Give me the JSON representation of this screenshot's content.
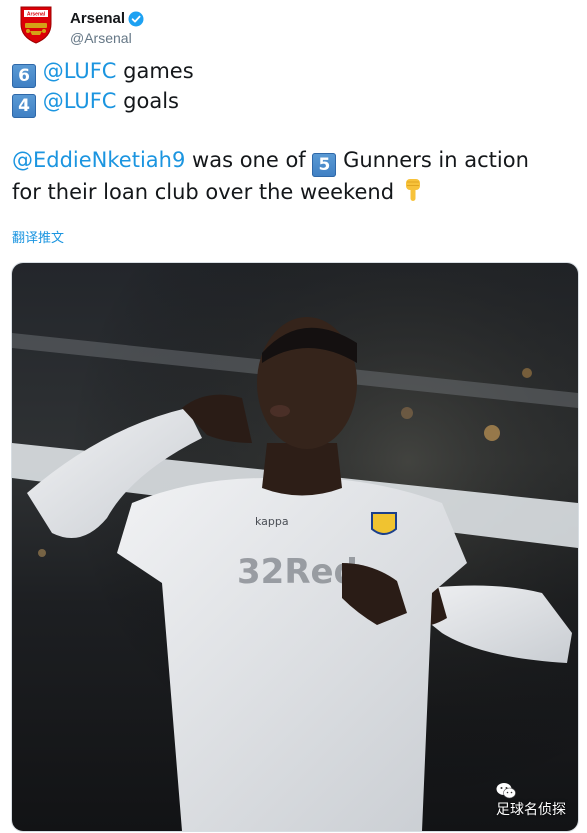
{
  "account": {
    "display_name": "Arsenal",
    "handle": "@Arsenal",
    "verified": true,
    "crest_icon": "arsenal-crest-icon"
  },
  "tweet": {
    "line1": {
      "badge": "6",
      "mention": "@LUFC",
      "text": "games"
    },
    "line2": {
      "badge": "4",
      "mention": "@LUFC",
      "text": "goals"
    },
    "line3": {
      "mention": "@EddieNketiah9",
      "text_before_badge": "was one of",
      "badge": "5",
      "text_after_badge": "Gunners in action"
    },
    "line4": {
      "text": "for their loan club over the weekend",
      "emoji": "pointing-down-hand"
    },
    "translate_link": "翻译推文"
  },
  "media": {
    "description_icon": "player-celebration-photo",
    "watermark_text": "足球名侦探"
  },
  "colors": {
    "link": "#1b95e0",
    "text": "#14171a",
    "secondary": "#657786",
    "keycap": "#4a8bd0",
    "verified": "#1da1f2"
  }
}
